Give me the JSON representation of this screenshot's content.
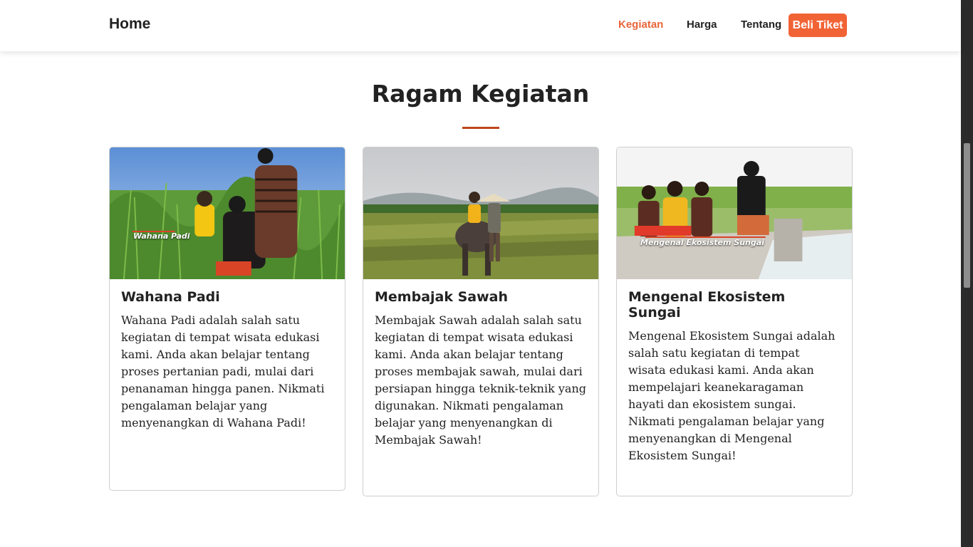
{
  "navbar": {
    "brand": "Home",
    "links": [
      "Kegiatan",
      "Harga",
      "Tentang"
    ],
    "cta": "Beli Tiket",
    "accent_color": "#f16335"
  },
  "section": {
    "title": "Ragam Kegiatan",
    "underline_color": "#c0461d"
  },
  "cards": [
    {
      "image_caption": "Wahana Padi",
      "title": "Wahana Padi",
      "text": "Wahana Padi adalah salah satu kegiatan di tempat wisata edukasi kami. Anda akan belajar tentang proses pertanian padi, mulai dari penanaman hingga panen. Nikmati pengalaman belajar yang menyenangkan di Wahana Padi!"
    },
    {
      "image_caption": "",
      "title": "Membajak Sawah",
      "text": "Membajak Sawah adalah salah satu kegiatan di tempat wisata edukasi kami. Anda akan belajar tentang proses membajak sawah, mulai dari persiapan hingga teknik-teknik yang digunakan. Nikmati pengalaman belajar yang menyenangkan di Membajak Sawah!"
    },
    {
      "image_caption": "Mengenal Ekosistem Sungai",
      "title": "Mengenal Ekosistem Sungai",
      "text": "Mengenal Ekosistem Sungai adalah salah satu kegiatan di tempat wisata edukasi kami. Anda akan mempelajari keanekaragaman hayati dan ekosistem sungai. Nikmati pengalaman belajar yang menyenangkan di Mengenal Ekosistem Sungai!"
    }
  ]
}
